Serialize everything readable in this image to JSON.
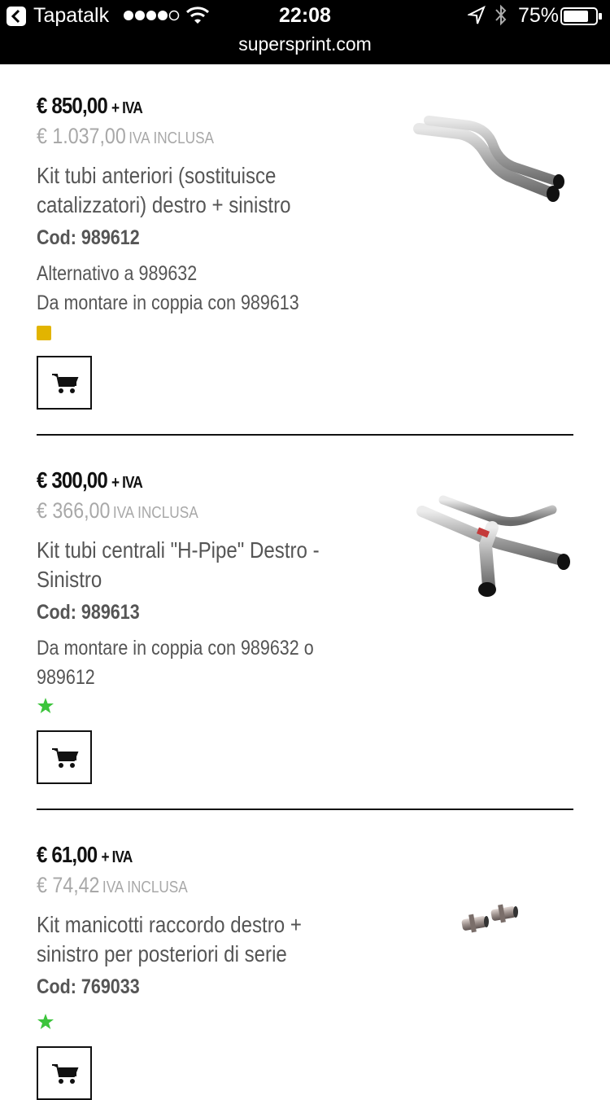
{
  "status_bar": {
    "app_name": "Tapatalk",
    "time": "22:08",
    "battery": "75%",
    "url": "supersprint.com"
  },
  "products": [
    {
      "price": "€ 850,00",
      "price_vat_note": "+ IVA",
      "price_incl": "€ 1.037,00",
      "price_incl_note": "IVA INCLUSA",
      "title": "Kit tubi anteriori (sostituisce catalizzatori) destro + sinistro",
      "code": "Cod: 989612",
      "notes": [
        "Alternativo a 989632",
        "Da montare in coppia con 989613"
      ],
      "badge": "yellow-square",
      "image": "front-pipes-kit-image"
    },
    {
      "price": "€ 300,00",
      "price_vat_note": "+ IVA",
      "price_incl": "€ 366,00",
      "price_incl_note": "IVA INCLUSA",
      "title": "Kit tubi centrali \"H-Pipe\" Destro - Sinistro",
      "code": "Cod: 989613",
      "notes": [
        "Da montare in coppia con 989632 o 989612"
      ],
      "badge": "green-star",
      "image": "h-pipe-kit-image"
    },
    {
      "price": "€ 61,00",
      "price_vat_note": "+ IVA",
      "price_incl": "€ 74,42",
      "price_incl_note": "IVA INCLUSA",
      "title": "Kit manicotti raccordo destro + sinistro per posteriori di serie",
      "code": "Cod: 769033",
      "notes": [],
      "badge": "green-star",
      "image": "sleeves-kit-image"
    }
  ],
  "colors": {
    "status_bar_bg": "#000000",
    "price_incl": "#a8a8a8",
    "text": "#555555",
    "badge_yellow": "#e2b400",
    "badge_green": "#3cc43c"
  }
}
